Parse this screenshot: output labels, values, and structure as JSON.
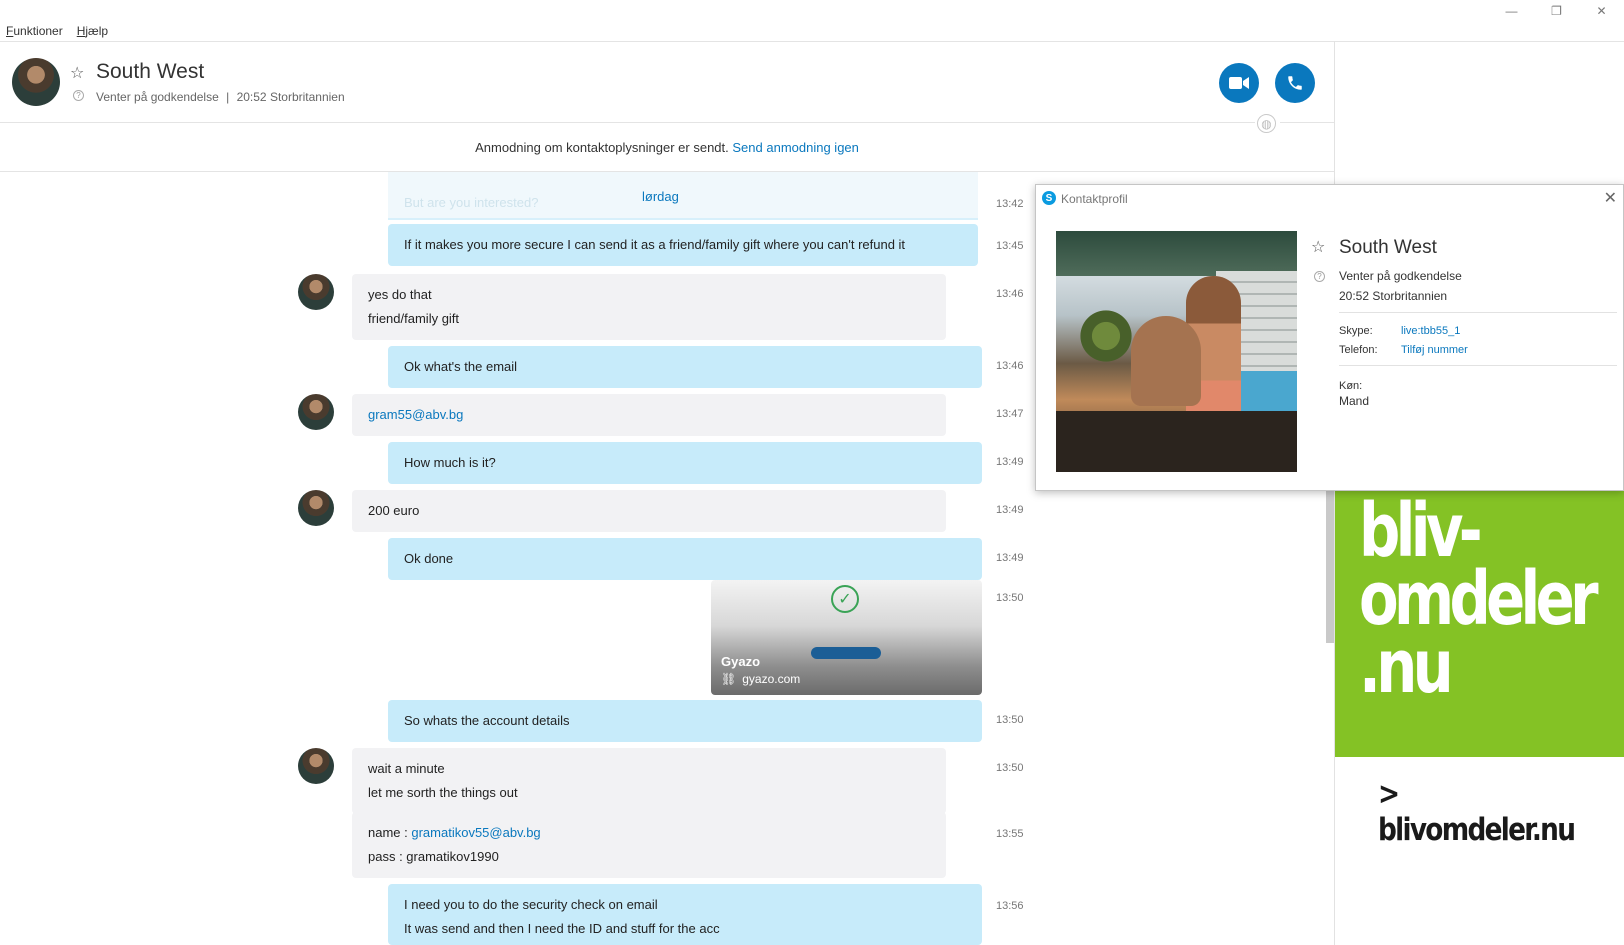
{
  "window": {
    "minimize": "—",
    "restore": "❐",
    "close": "✕"
  },
  "menu": [
    "Funktioner",
    "Hjælp"
  ],
  "header": {
    "name": "South West",
    "status": "Venter på godkendelse",
    "separator": "|",
    "local_time": "20:52 Storbritannien"
  },
  "request": {
    "text": "Anmodning om kontaktoplysninger er sendt.",
    "link": "Send anmodning igen"
  },
  "chat": {
    "faded_text": "But are you interested?",
    "day_label": "lørdag",
    "faded_time": "13:42",
    "messages": [
      {
        "dir": "out",
        "lines": [
          "If it makes you more secure I can send it as a friend/family gift where you can't refund it"
        ],
        "time": "13:45"
      },
      {
        "dir": "in",
        "lines": [
          "yes do that",
          "friend/family gift"
        ],
        "time": "13:46"
      },
      {
        "dir": "out",
        "lines": [
          "Ok what's the email"
        ],
        "time": "13:46"
      },
      {
        "dir": "in",
        "link": "gram55@abv.bg",
        "time": "13:47"
      },
      {
        "dir": "out",
        "lines": [
          "How much is it?"
        ],
        "time": "13:49"
      },
      {
        "dir": "in",
        "lines": [
          "200 euro"
        ],
        "time": "13:49"
      },
      {
        "dir": "out",
        "lines": [
          "Ok done"
        ],
        "time": "13:49"
      },
      {
        "dir": "out",
        "link_preview": {
          "title": "Gyazo",
          "domain": "gyazo.com"
        },
        "time": "13:50"
      },
      {
        "dir": "out",
        "lines": [
          "So whats the account details"
        ],
        "time": "13:50"
      },
      {
        "dir": "in",
        "lines": [
          "wait a minute",
          "let me sorth the things out"
        ],
        "time": "13:50"
      },
      {
        "dir": "in",
        "name_label": "name : ",
        "name_link": "gramatikov55@abv.bg",
        "pass_line": "pass : gramatikov1990",
        "time": "13:55"
      },
      {
        "dir": "out",
        "lines": [
          "I need you to do the security check on email",
          "It was send and then I need the ID and stuff for the acc"
        ],
        "time": "13:56"
      }
    ]
  },
  "profile": {
    "title": "Kontaktprofil",
    "close": "✕",
    "name": "South West",
    "status": "Venter på godkendelse",
    "local_time": "20:52 Storbritannien",
    "skype_label": "Skype:",
    "skype_value": "live:tbb55_1",
    "phone_label": "Telefon:",
    "phone_value": "Tilføj nummer",
    "gender_label": "Køn:",
    "gender_value": "Mand"
  },
  "ad": {
    "lines": [
      "bliv-",
      "omdeler",
      ".nu"
    ],
    "link": "> blivomdeler.nu",
    "color": "#84c225"
  },
  "colors": {
    "accent": "#0a78be",
    "outgoing_bubble": "#c7ebfa",
    "incoming_bubble": "#f2f2f4"
  }
}
